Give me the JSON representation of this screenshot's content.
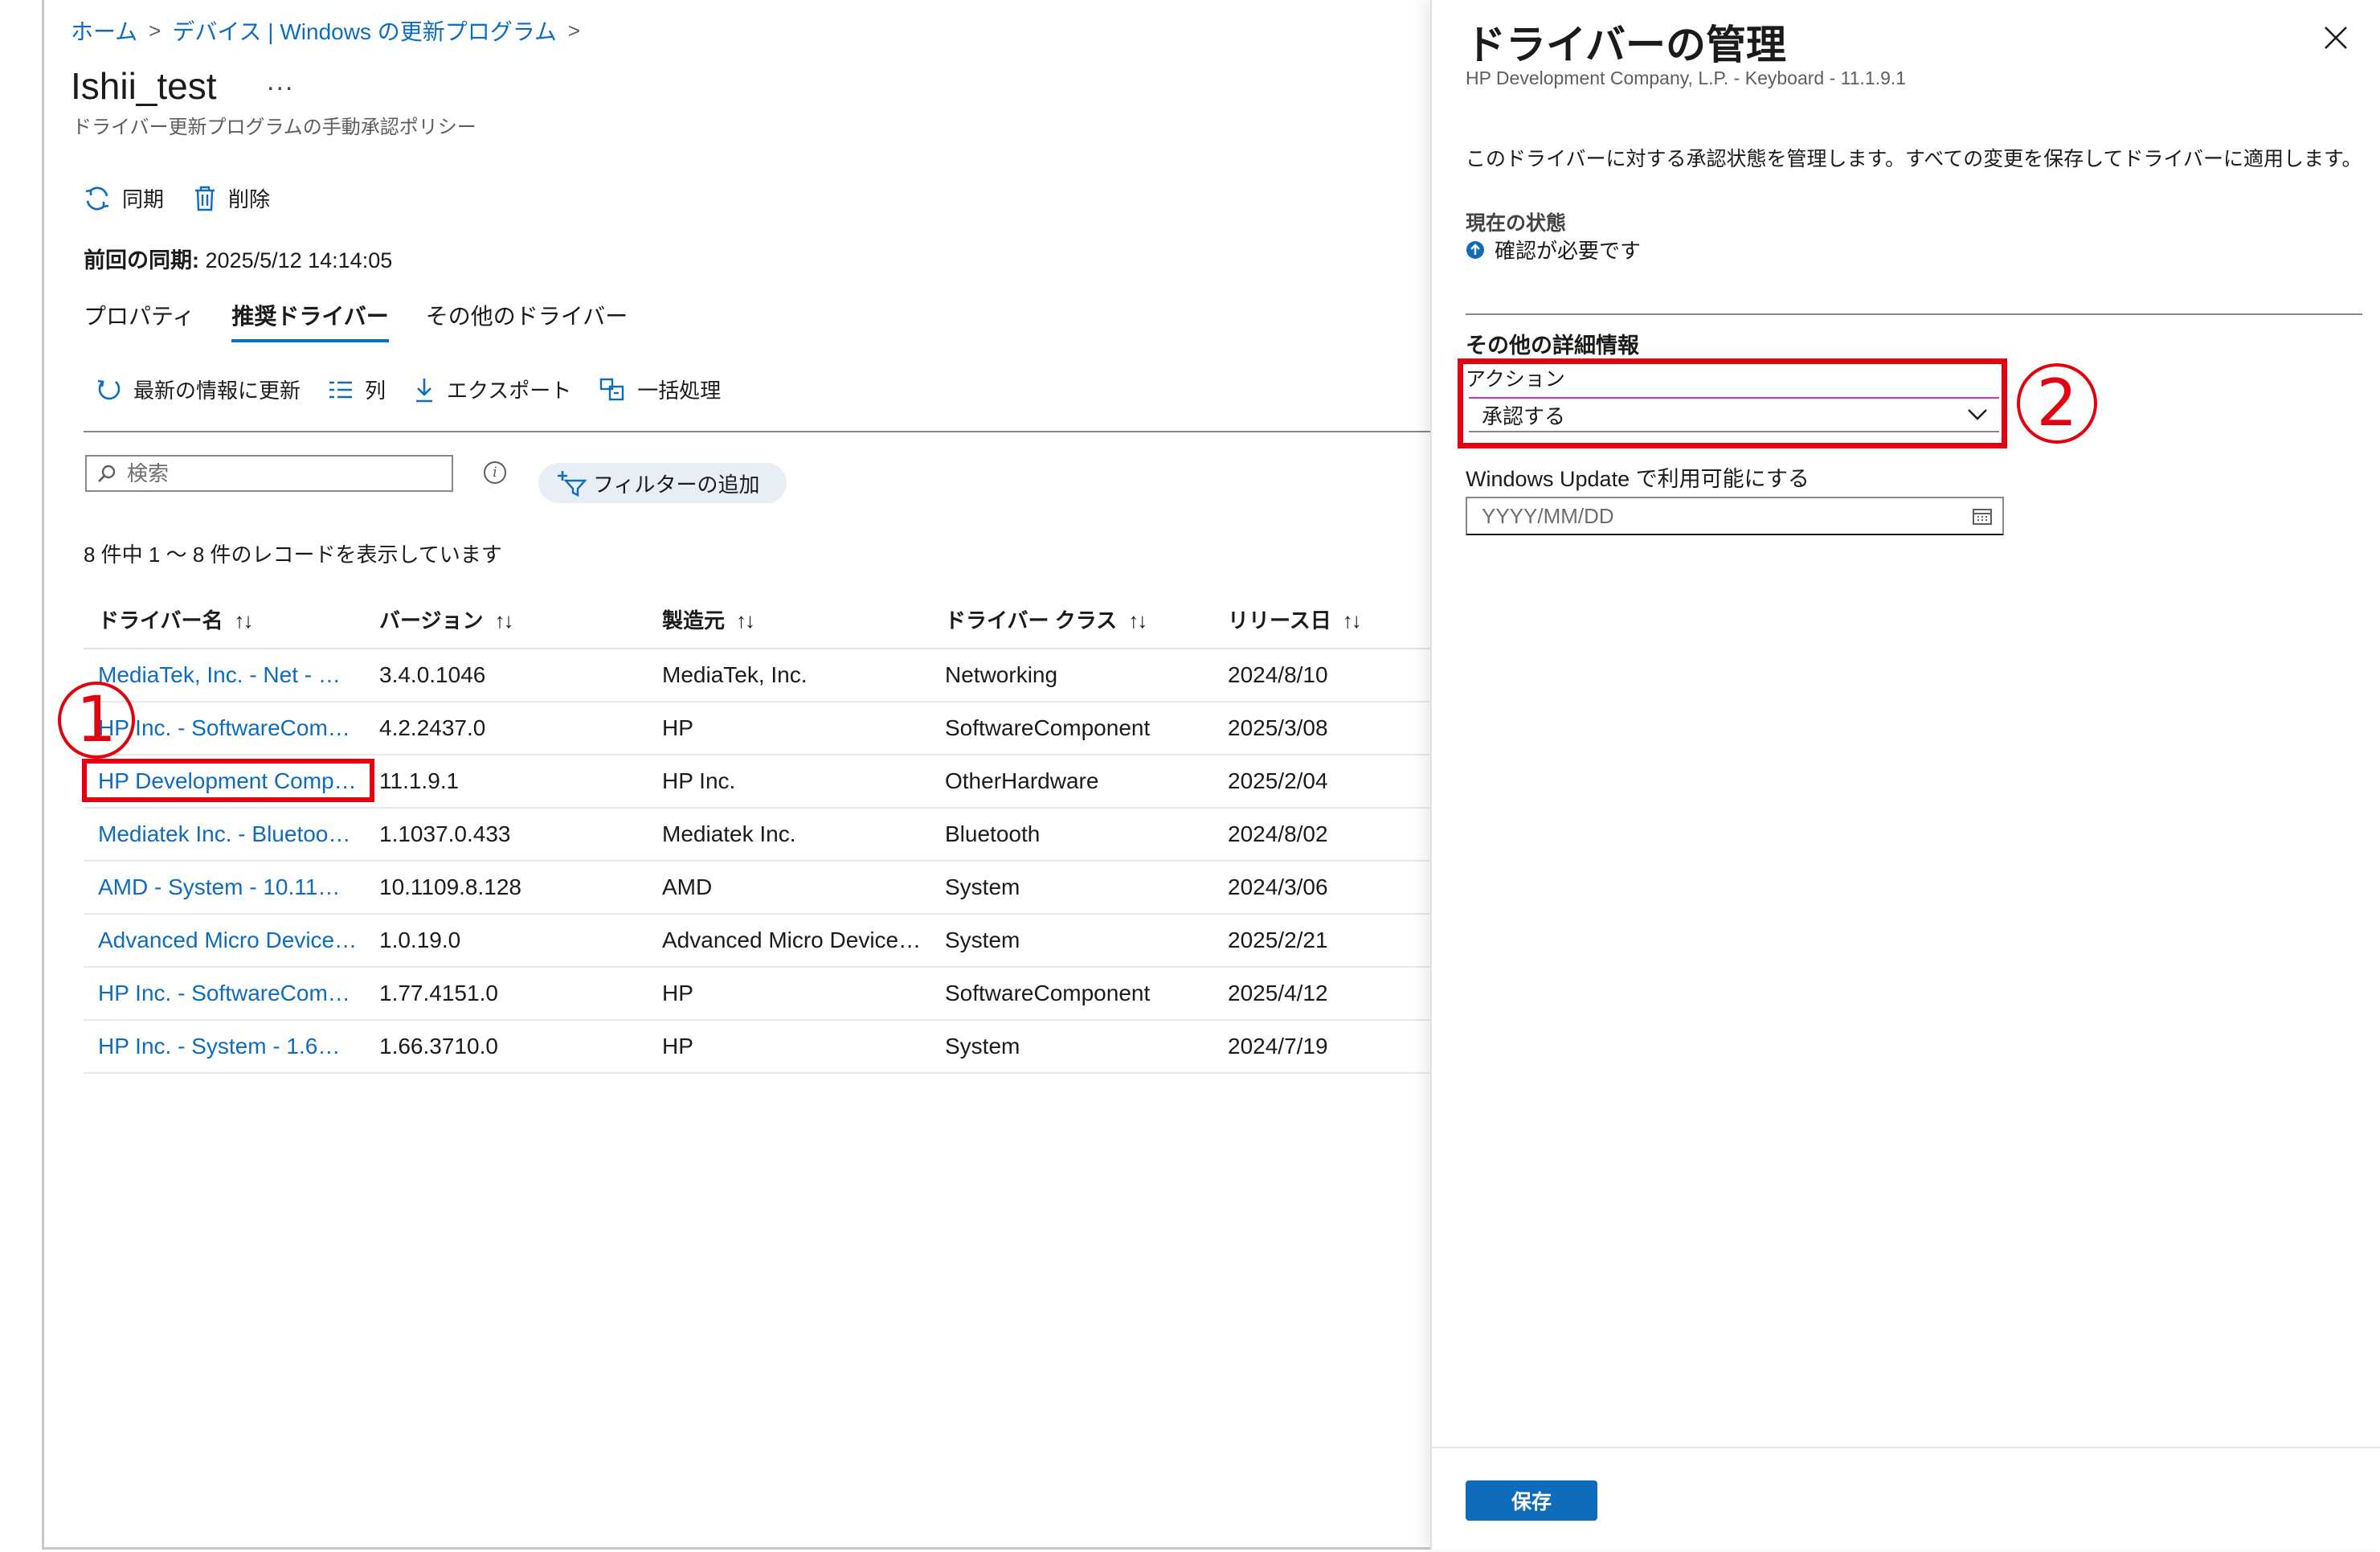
{
  "breadcrumb": {
    "home": "ホーム",
    "sep": ">",
    "parent": "デバイス | Windows の更新プログラム"
  },
  "page": {
    "title": "Ishii_test",
    "more": "...",
    "subtitle": "ドライバー更新プログラムの手動承認ポリシー"
  },
  "commands": {
    "sync": "同期",
    "delete": "削除"
  },
  "last_sync": {
    "label": "前回の同期:",
    "value": "2025/5/12 14:14:05"
  },
  "tabs": [
    {
      "label": "プロパティ",
      "active": false
    },
    {
      "label": "推奨ドライバー",
      "active": true
    },
    {
      "label": "その他のドライバー",
      "active": false
    }
  ],
  "toolbar": {
    "refresh": "最新の情報に更新",
    "columns": "列",
    "export": "エクスポート",
    "bulk": "一括処理"
  },
  "search": {
    "placeholder": "検索"
  },
  "filter": {
    "label": "フィルターの追加"
  },
  "records_text": "8 件中 1 ～ 8 件のレコードを表示しています",
  "table": {
    "sort_glyph": "↑↓",
    "headers": [
      "ドライバー名",
      "バージョン",
      "製造元",
      "ドライバー クラス",
      "リリース日"
    ],
    "rows": [
      [
        "MediaTek, Inc. - Net - …",
        "3.4.0.1046",
        "MediaTek, Inc.",
        "Networking",
        "2024/8/10"
      ],
      [
        "HP Inc. - SoftwareCom…",
        "4.2.2437.0",
        "HP",
        "SoftwareComponent",
        "2025/3/08"
      ],
      [
        "HP Development Comp…",
        "11.1.9.1",
        "HP Inc.",
        "OtherHardware",
        "2025/2/04"
      ],
      [
        "Mediatek Inc. - Bluetoo…",
        "1.1037.0.433",
        "Mediatek Inc.",
        "Bluetooth",
        "2024/8/02"
      ],
      [
        "AMD - System - 10.11…",
        "10.1109.8.128",
        "AMD",
        "System",
        "2024/3/06"
      ],
      [
        "Advanced Micro Device…",
        "1.0.19.0",
        "Advanced Micro Device…",
        "System",
        "2025/2/21"
      ],
      [
        "HP Inc. - SoftwareCom…",
        "1.77.4151.0",
        "HP",
        "SoftwareComponent",
        "2025/4/12"
      ],
      [
        "HP Inc. - System - 1.6…",
        "1.66.3710.0",
        "HP",
        "System",
        "2024/7/19"
      ]
    ]
  },
  "annotations": {
    "step1": "1",
    "step2": "2",
    "color": "#e3000f"
  },
  "panel": {
    "title": "ドライバーの管理",
    "subtitle": "HP Development Company, L.P. - Keyboard - 11.1.9.1",
    "description": "このドライバーに対する承認状態を管理します。すべての変更を保存してドライバーに適用します。",
    "status_label": "現在の状態",
    "status_value": "確認が必要です",
    "details_heading": "その他の詳細情報",
    "action_label": "アクション",
    "action_value": "承認する",
    "availability_label": "Windows Update で利用可能にする",
    "date_placeholder": "YYYY/MM/DD",
    "save": "保存"
  },
  "colors": {
    "accent": "#0f6cbd",
    "link": "#0f6cbd",
    "annotation": "#e3000f"
  }
}
